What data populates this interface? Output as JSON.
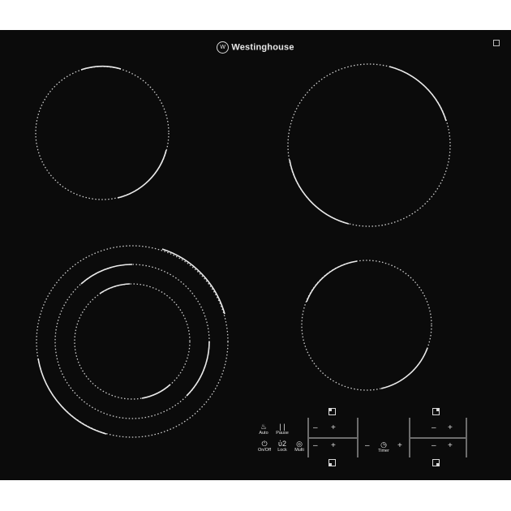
{
  "brand": {
    "name": "Westinghouse",
    "logo_letter": "W"
  },
  "controls": {
    "auto_label": "Auto",
    "pause_label": "Pause",
    "onoff_label": "On/Off",
    "lock_label": "Lock",
    "multi_label": "Multi",
    "timer_label": "Timer",
    "minus": "–",
    "plus": "+",
    "auto_symbol": "♨",
    "pause_symbol": "| |",
    "onoff_symbol": "⏻",
    "lock_symbol": "ὑ2",
    "multi_symbol": "◎",
    "timer_symbol": "◷"
  },
  "icons": {
    "cooking_zones": [
      "front-left-triple-zone-icon",
      "rear-left-zone-icon",
      "rear-right-zone-icon",
      "front-right-zone-icon"
    ]
  },
  "colors": {
    "glass": "#0b0b0b",
    "ring": "#d8d8d8"
  }
}
